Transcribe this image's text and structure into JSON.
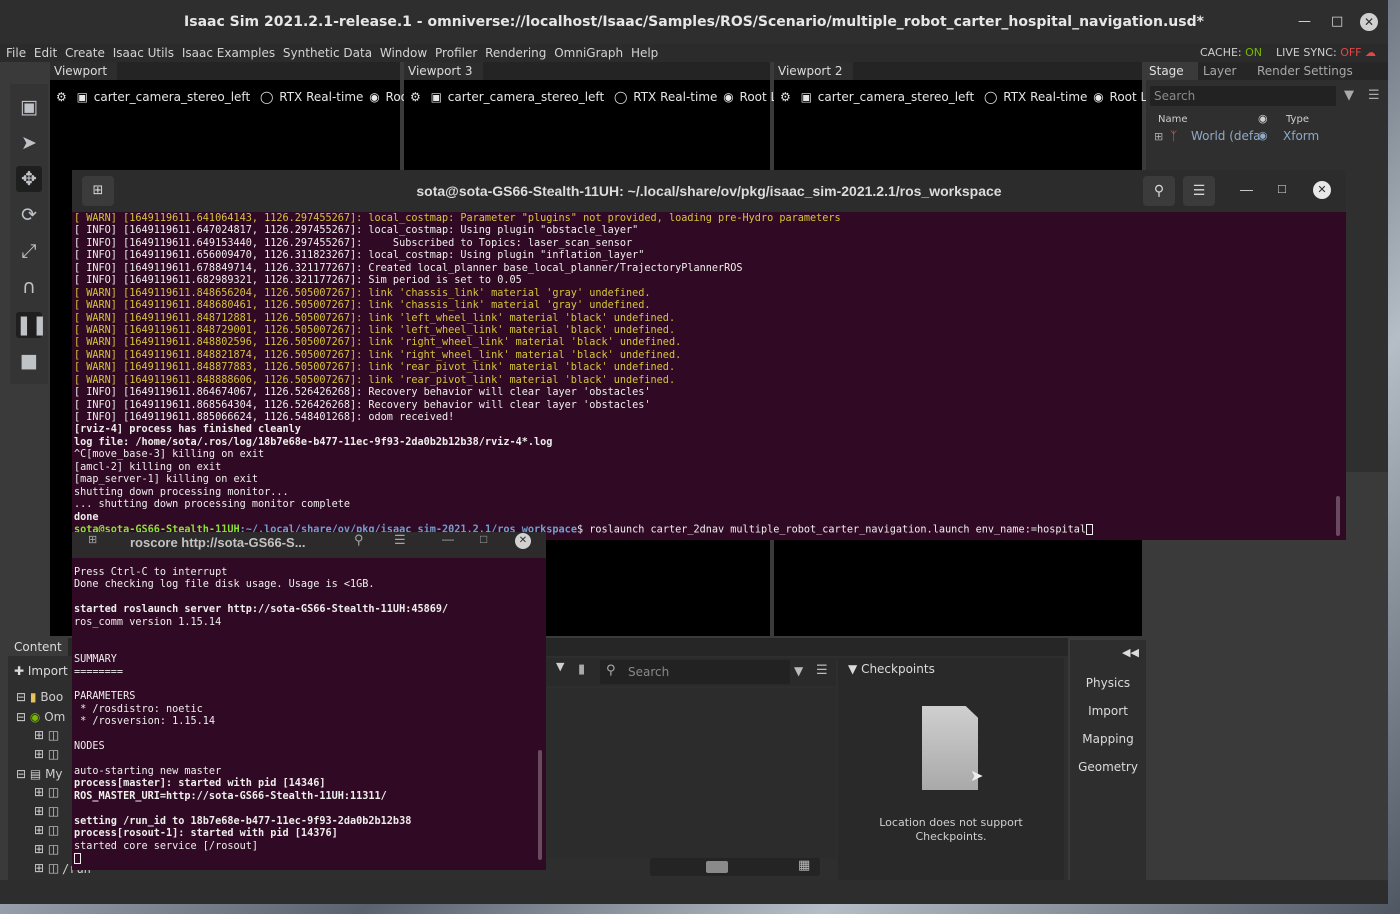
{
  "isaac": {
    "title": "Isaac Sim 2021.2.1-release.1 - omniverse://localhost/Isaac/Samples/ROS/Scenario/multiple_robot_carter_hospital_navigation.usd*",
    "menu": [
      "File",
      "Edit",
      "Create",
      "Isaac Utils",
      "Isaac Examples",
      "Synthetic Data",
      "Window",
      "Profiler",
      "Rendering",
      "OmniGraph",
      "Help"
    ],
    "cache_label": "CACHE:",
    "cache_value": "ON",
    "live_sync_label": "LIVE SYNC:",
    "live_sync_value": "OFF",
    "viewports": [
      {
        "tab": "Viewport",
        "camera": "carter_camera_stereo_left",
        "renderer": "RTX Real-time",
        "layer": "Root Layer"
      },
      {
        "tab": "Viewport 3",
        "camera": "carter_camera_stereo_left",
        "renderer": "RTX Real-time",
        "layer": "Root Layer"
      },
      {
        "tab": "Viewport 2",
        "camera": "carter_camera_stereo_left",
        "renderer": "RTX Real-time",
        "layer": "Root Layer"
      }
    ],
    "stage": {
      "tabs": [
        "Stage",
        "Layer",
        "Render Settings"
      ],
      "search_placeholder": "Search",
      "col_name": "Name",
      "col_type": "Type",
      "row_name": "World (defa",
      "row_type": "Xform"
    },
    "content": {
      "tab": "Content",
      "import_label": "Import",
      "search_placeholder": "Search",
      "tree": [
        "Boo",
        "Om",
        "My"
      ],
      "run_label": "/run"
    },
    "checkpoints": {
      "title": "Checkpoints",
      "message": "Location does not support Checkpoints."
    },
    "right_tools": [
      "Physics",
      "Import",
      "Mapping",
      "Geometry"
    ]
  },
  "term1": {
    "title": "sota@sota-GS66-Stealth-11UH: ~/.local/share/ov/pkg/isaac_sim-2021.2.1/ros_workspace",
    "lines": [
      {
        "t": "[ WARN] [1649119611.641064143, 1126.297455267]: local_costmap: Parameter \"plugins\" not provided, loading pre-Hydro parameters",
        "c": "warn"
      },
      {
        "t": "[ INFO] [1649119611.647024817, 1126.297455267]: local_costmap: Using plugin \"obstacle_layer\"",
        "c": ""
      },
      {
        "t": "[ INFO] [1649119611.649153440, 1126.297455267]:     Subscribed to Topics: laser_scan_sensor",
        "c": ""
      },
      {
        "t": "[ INFO] [1649119611.656009470, 1126.311823267]: local_costmap: Using plugin \"inflation_layer\"",
        "c": ""
      },
      {
        "t": "[ INFO] [1649119611.678849714, 1126.321177267]: Created local_planner base_local_planner/TrajectoryPlannerROS",
        "c": ""
      },
      {
        "t": "[ INFO] [1649119611.682989321, 1126.321177267]: Sim period is set to 0.05",
        "c": ""
      },
      {
        "t": "[ WARN] [1649119611.848656204, 1126.505007267]: link 'chassis_link' material 'gray' undefined.",
        "c": "warn"
      },
      {
        "t": "[ WARN] [1649119611.848680461, 1126.505007267]: link 'chassis_link' material 'gray' undefined.",
        "c": "warn"
      },
      {
        "t": "[ WARN] [1649119611.848712881, 1126.505007267]: link 'left_wheel_link' material 'black' undefined.",
        "c": "warn"
      },
      {
        "t": "[ WARN] [1649119611.848729001, 1126.505007267]: link 'left_wheel_link' material 'black' undefined.",
        "c": "warn"
      },
      {
        "t": "[ WARN] [1649119611.848802596, 1126.505007267]: link 'right_wheel_link' material 'black' undefined.",
        "c": "warn"
      },
      {
        "t": "[ WARN] [1649119611.848821874, 1126.505007267]: link 'right_wheel_link' material 'black' undefined.",
        "c": "warn"
      },
      {
        "t": "[ WARN] [1649119611.848877883, 1126.505007267]: link 'rear_pivot_link' material 'black' undefined.",
        "c": "warn"
      },
      {
        "t": "[ WARN] [1649119611.848888606, 1126.505007267]: link 'rear_pivot_link' material 'black' undefined.",
        "c": "warn"
      },
      {
        "t": "[ INFO] [1649119611.864674067, 1126.526426268]: Recovery behavior will clear layer 'obstacles'",
        "c": ""
      },
      {
        "t": "[ INFO] [1649119611.868564304, 1126.526426268]: Recovery behavior will clear layer 'obstacles'",
        "c": ""
      },
      {
        "t": "[ INFO] [1649119611.885066624, 1126.548401268]: odom received!",
        "c": ""
      },
      {
        "t": "[rviz-4] process has finished cleanly",
        "c": "bold"
      },
      {
        "t": "log file: /home/sota/.ros/log/18b7e68e-b477-11ec-9f93-2da0b2b12b38/rviz-4*.log",
        "c": "bold"
      },
      {
        "t": "^C[move_base-3] killing on exit",
        "c": ""
      },
      {
        "t": "[amcl-2] killing on exit",
        "c": ""
      },
      {
        "t": "[map_server-1] killing on exit",
        "c": ""
      },
      {
        "t": "shutting down processing monitor...",
        "c": ""
      },
      {
        "t": "... shutting down processing monitor complete",
        "c": ""
      },
      {
        "t": "done",
        "c": "bold"
      }
    ],
    "prompt_user": "sota@sota-GS66-Stealth-11UH",
    "prompt_path": ":~/.local/share/ov/pkg/isaac_sim-2021.2.1/ros_workspace",
    "prompt_cmd": "$ roslaunch carter_2dnav multiple_robot_carter_navigation.launch env_name:=hospital"
  },
  "term2": {
    "title": "roscore http://sota-GS66-S...",
    "lines": [
      {
        "t": "Press Ctrl-C to interrupt",
        "c": ""
      },
      {
        "t": "Done checking log file disk usage. Usage is <1GB.",
        "c": ""
      },
      {
        "t": "",
        "c": ""
      },
      {
        "t": "started roslaunch server http://sota-GS66-Stealth-11UH:45869/",
        "c": "bold"
      },
      {
        "t": "ros_comm version 1.15.14",
        "c": ""
      },
      {
        "t": "",
        "c": ""
      },
      {
        "t": "",
        "c": ""
      },
      {
        "t": "SUMMARY",
        "c": ""
      },
      {
        "t": "========",
        "c": ""
      },
      {
        "t": "",
        "c": ""
      },
      {
        "t": "PARAMETERS",
        "c": ""
      },
      {
        "t": " * /rosdistro: noetic",
        "c": ""
      },
      {
        "t": " * /rosversion: 1.15.14",
        "c": ""
      },
      {
        "t": "",
        "c": ""
      },
      {
        "t": "NODES",
        "c": ""
      },
      {
        "t": "",
        "c": ""
      },
      {
        "t": "auto-starting new master",
        "c": ""
      },
      {
        "t": "process[master]: started with pid [14346]",
        "c": "bold"
      },
      {
        "t": "ROS_MASTER_URI=http://sota-GS66-Stealth-11UH:11311/",
        "c": "bold"
      },
      {
        "t": "",
        "c": ""
      },
      {
        "t": "setting /run_id to 18b7e68e-b477-11ec-9f93-2da0b2b12b38",
        "c": "bold"
      },
      {
        "t": "process[rosout-1]: started with pid [14376]",
        "c": "bold"
      },
      {
        "t": "started core service [/rosout]",
        "c": ""
      }
    ]
  }
}
